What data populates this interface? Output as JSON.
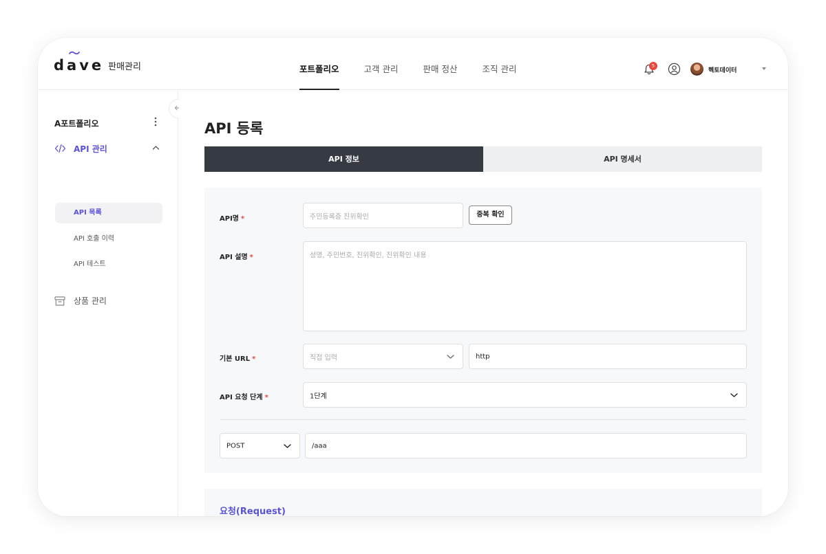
{
  "brand": {
    "logo_text": "dave",
    "product_name": "판매관리",
    "accent_color": "#5a53d6"
  },
  "nav": {
    "items": [
      {
        "label": "포트폴리오",
        "active": true
      },
      {
        "label": "고객 관리",
        "active": false
      },
      {
        "label": "판매 정산",
        "active": false
      },
      {
        "label": "조직 관리",
        "active": false
      }
    ]
  },
  "header": {
    "notification_count": "5",
    "notification_icon": "bell-icon",
    "user_icon": "user-circle-icon",
    "user_name": "헥토데이터"
  },
  "sidebar": {
    "portfolio_title": "A포트폴리오",
    "menu": [
      {
        "label": "API 관리",
        "icon": "code-icon",
        "expanded": true,
        "children": [
          {
            "label": "API 목록",
            "active": true
          },
          {
            "label": "API 호출 이력",
            "active": false
          },
          {
            "label": "API 테스트",
            "active": false
          }
        ]
      },
      {
        "label": "상품 관리",
        "icon": "box-icon",
        "expanded": false
      }
    ]
  },
  "main": {
    "page_title": "API 등록",
    "tabs": [
      {
        "label": "API 정보",
        "active": true
      },
      {
        "label": "API 명세서",
        "active": false
      }
    ],
    "form": {
      "api_name": {
        "label": "API명",
        "required_mark": "*",
        "placeholder": "주민등록증 진위확인",
        "value": ""
      },
      "duplicate_check_button": "중복 확인",
      "api_description": {
        "label": "API 설명",
        "required_mark": "*",
        "placeholder": "성명, 주민번호, 진위확인, 진위확인 내용",
        "value": ""
      },
      "base_url": {
        "label": "기본 URL",
        "required_mark": "*",
        "select_placeholder": "직접 입력",
        "value": "http"
      },
      "request_step": {
        "label": "API 요청 단계",
        "required_mark": "*",
        "value": "1단계"
      },
      "method": {
        "value": "POST"
      },
      "path": {
        "value": "/aaa"
      }
    },
    "request_section_title": "요청(Request)"
  }
}
